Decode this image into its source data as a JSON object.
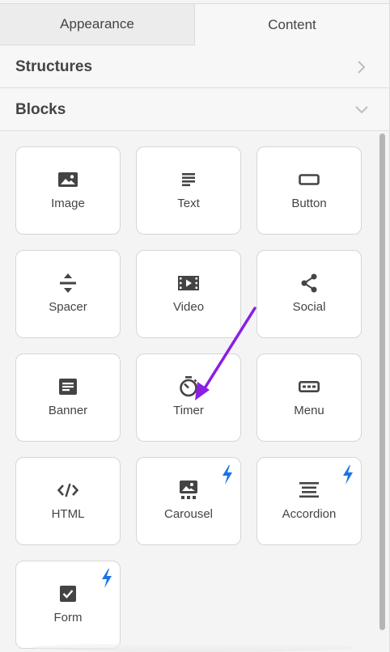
{
  "tabs": [
    {
      "label": "Appearance",
      "active": false
    },
    {
      "label": "Content",
      "active": true
    }
  ],
  "sections": {
    "structures": {
      "title": "Structures",
      "expanded": false
    },
    "blocks": {
      "title": "Blocks",
      "expanded": true
    }
  },
  "blocks": [
    {
      "label": "Image",
      "icon": "image-icon",
      "premium": false
    },
    {
      "label": "Text",
      "icon": "text-icon",
      "premium": false
    },
    {
      "label": "Button",
      "icon": "button-icon",
      "premium": false
    },
    {
      "label": "Spacer",
      "icon": "spacer-icon",
      "premium": false
    },
    {
      "label": "Video",
      "icon": "video-icon",
      "premium": false
    },
    {
      "label": "Social",
      "icon": "share-icon",
      "premium": false
    },
    {
      "label": "Banner",
      "icon": "banner-icon",
      "premium": false
    },
    {
      "label": "Timer",
      "icon": "timer-icon",
      "premium": false
    },
    {
      "label": "Menu",
      "icon": "menu-icon",
      "premium": false
    },
    {
      "label": "HTML",
      "icon": "code-icon",
      "premium": false
    },
    {
      "label": "Carousel",
      "icon": "carousel-icon",
      "premium": true
    },
    {
      "label": "Accordion",
      "icon": "accordion-icon",
      "premium": true
    },
    {
      "label": "Form",
      "icon": "checkbox-icon",
      "premium": true
    }
  ],
  "colors": {
    "icon": "#444444",
    "premium_bolt": "#1a73e8",
    "annotation_arrow": "#8a1ee6"
  }
}
